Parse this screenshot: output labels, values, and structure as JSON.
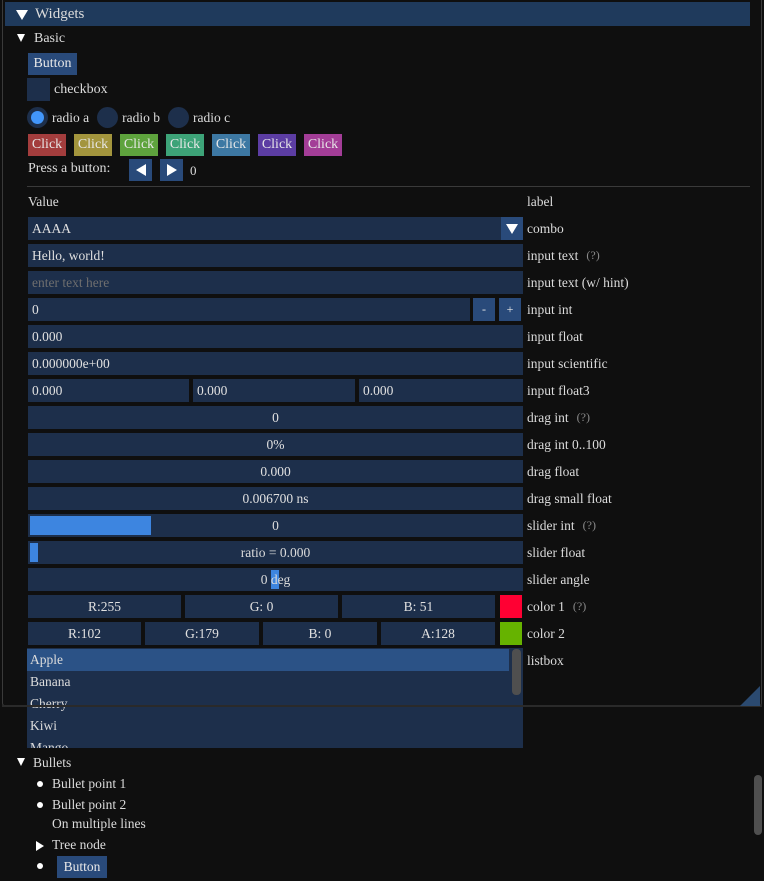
{
  "window": {
    "title": "Widgets",
    "section": "Basic"
  },
  "basic": {
    "button": "Button",
    "checkbox": "checkbox",
    "checkbox_checked": false,
    "radios": [
      {
        "label": "radio a",
        "selected": true
      },
      {
        "label": "radio b",
        "selected": false
      },
      {
        "label": "radio c",
        "selected": false
      }
    ],
    "click_buttons": [
      {
        "label": "Click",
        "color": "#a33d3d"
      },
      {
        "label": "Click",
        "color": "#a3953d"
      },
      {
        "label": "Click",
        "color": "#5ea33d"
      },
      {
        "label": "Click",
        "color": "#3da378"
      },
      {
        "label": "Click",
        "color": "#3d78a3"
      },
      {
        "label": "Click",
        "color": "#5c3da3"
      },
      {
        "label": "Click",
        "color": "#a33d97"
      }
    ],
    "press_label": "Press a button:",
    "press_count": "0"
  },
  "table_header": {
    "value": "Value",
    "label": "label"
  },
  "rows": {
    "combo": {
      "value": "AAAA",
      "label": "combo"
    },
    "input_text": {
      "value": "Hello, world!",
      "label": "input text",
      "help": "(?)"
    },
    "input_hint": {
      "placeholder": "enter text here",
      "label": "input text (w/ hint)"
    },
    "input_int": {
      "value": "0",
      "minus": "-",
      "plus": "+",
      "label": "input int"
    },
    "input_float": {
      "value": "0.000",
      "label": "input float"
    },
    "input_sci": {
      "value": "0.000000e+00",
      "label": "input scientific"
    },
    "input_float3": {
      "values": [
        "0.000",
        "0.000",
        "0.000"
      ],
      "label": "input float3"
    },
    "drag_int": {
      "value": "0",
      "label": "drag int",
      "help": "(?)"
    },
    "drag_int100": {
      "value": "0%",
      "label": "drag int 0..100"
    },
    "drag_float": {
      "value": "0.000",
      "label": "drag float"
    },
    "drag_small": {
      "value": "0.006700 ns",
      "label": "drag small float"
    },
    "slider_int": {
      "value": "0",
      "label": "slider int",
      "help": "(?)",
      "range": [
        -1,
        3
      ]
    },
    "slider_float": {
      "value": "ratio = 0.000",
      "label": "slider float"
    },
    "slider_angle": {
      "value": "0 deg",
      "label": "slider angle"
    },
    "color1": {
      "fields": [
        "R:255",
        "G:  0",
        "B: 51"
      ],
      "swatch": "#ff0033",
      "label": "color 1",
      "help": "(?)"
    },
    "color2": {
      "fields": [
        "R:102",
        "G:179",
        "B:  0",
        "A:128"
      ],
      "swatch": "#66b300",
      "label": "color 2"
    },
    "listbox": {
      "items": [
        "Apple",
        "Banana",
        "Cherry",
        "Kiwi",
        "Mango"
      ],
      "selected": "Apple",
      "label": "listbox"
    }
  },
  "bullets": {
    "title": "Bullets",
    "items": [
      "Bullet point 1",
      "Bullet point 2",
      "On multiple lines",
      "Tree node",
      "Button"
    ]
  }
}
